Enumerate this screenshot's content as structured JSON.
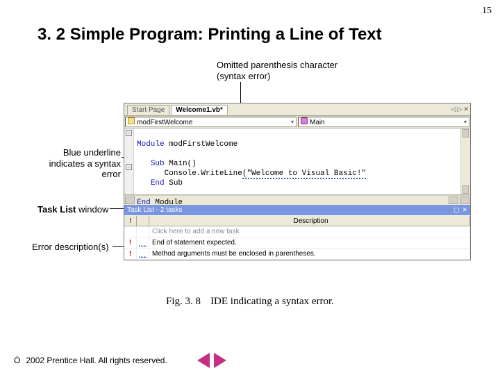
{
  "page_number": "15",
  "title": "3. 2 Simple Program: Printing a Line of Text",
  "annotations": {
    "omitted": "Omitted parenthesis character\n(syntax error)",
    "blue_underline": "Blue underline indicates a syntax error",
    "tasklist_bold": "Task List",
    "tasklist_rest": " window",
    "error_desc": "Error description(s)"
  },
  "ide": {
    "tabs": {
      "start": "Start Page",
      "active": "Welcome1.vb*"
    },
    "tab_controls": [
      "◁",
      "▷",
      "✕"
    ],
    "object_combo": "modFirstWelcome",
    "method_combo": "Main",
    "chevron": "▾",
    "code": {
      "l1a": "Module",
      "l1b": " modFirstWelcome",
      "l3a": "Sub",
      "l3b": " Main()",
      "l4a": "   Console.WriteLine",
      "l4err": "(\"Welcome to Visual Basic!\"",
      "l5a": "End",
      "l5b": " Sub",
      "l7a": "End",
      "l7b": " Module"
    },
    "tasklist": {
      "title": "Task List - 2 tasks",
      "close_controls": [
        "▢",
        "✕"
      ],
      "headers": {
        "bang": "!",
        "check": "",
        "desc": "Description"
      },
      "rows": [
        {
          "bang": "",
          "icon": "",
          "desc": "Click here to add a new task",
          "hint": true
        },
        {
          "bang": "!",
          "icon": "wave",
          "desc": "End of statement expected."
        },
        {
          "bang": "!",
          "icon": "wave",
          "desc": "Method arguments must be enclosed in parentheses."
        }
      ]
    }
  },
  "caption": {
    "fignum": "Fig. 3. 8",
    "text": "IDE indicating a syntax error."
  },
  "footer": {
    "copyright": " 2002 Prentice Hall. All rights reserved."
  }
}
